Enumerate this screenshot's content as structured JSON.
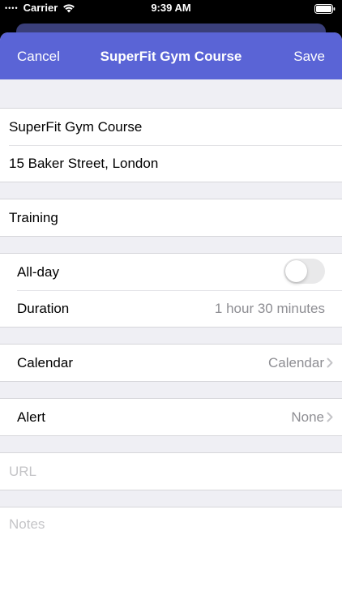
{
  "status_bar": {
    "signal": "••••",
    "carrier": "Carrier",
    "time": "9:39 AM",
    "wifi_icon": "wifi-icon",
    "battery_icon": "battery-full-icon"
  },
  "navbar": {
    "cancel_label": "Cancel",
    "title": "SuperFit Gym Course",
    "save_label": "Save",
    "color": "#5a64d6"
  },
  "event": {
    "title_value": "SuperFit Gym Course",
    "location_value": "15 Baker Street, London",
    "category_value": "Training"
  },
  "schedule": {
    "all_day_label": "All-day",
    "all_day_on": false,
    "duration_label": "Duration",
    "duration_value": "1 hour 30 minutes"
  },
  "calendar": {
    "label": "Calendar",
    "value": "Calendar",
    "icon": "chevron-right-icon"
  },
  "alert": {
    "label": "Alert",
    "value": "None",
    "icon": "chevron-right-icon"
  },
  "url": {
    "placeholder": "URL"
  },
  "notes": {
    "placeholder": "Notes"
  }
}
